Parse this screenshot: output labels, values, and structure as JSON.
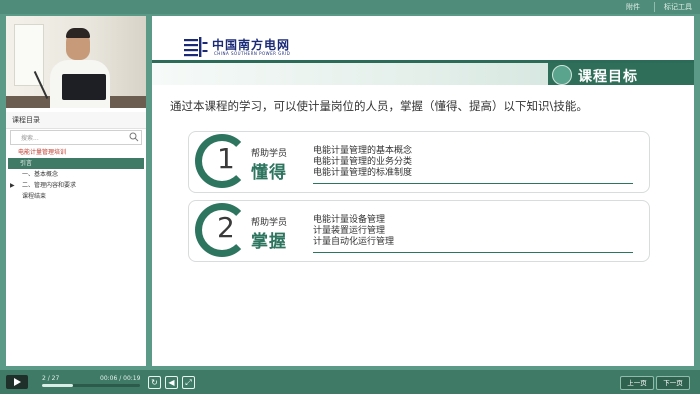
{
  "topbar": {
    "attachment": "附件",
    "tools": "标记工具"
  },
  "sidebar": {
    "catalog_title": "课程目录",
    "search_placeholder": "搜索...",
    "tree": [
      {
        "label": "电能计量管理培训",
        "style": "red"
      },
      {
        "label": "引言",
        "style": "selected"
      },
      {
        "label": "一、基本概念",
        "style": "normal"
      },
      {
        "label": "二、管理内容和要求",
        "style": "collapsed"
      },
      {
        "label": "课程结束",
        "style": "normal"
      }
    ]
  },
  "slide": {
    "logo_cn": "中国南方电网",
    "logo_en": "CHINA SOUTHERN POWER GRID",
    "banner_title": "课程目标",
    "intro": "通过本课程的学习，可以使计量岗位的人员，掌握（懂得、提高）以下知识\\技能。",
    "cards": [
      {
        "number": "1",
        "help": "帮助学员",
        "verb": "懂得",
        "items": [
          "电能计量管理的基本概念",
          "电能计量管理的业务分类",
          "电能计量管理的标准制度"
        ]
      },
      {
        "number": "2",
        "help": "帮助学员",
        "verb": "掌握",
        "items": [
          "电能计量设备管理",
          "计量装置运行管理",
          "计量自动化运行管理"
        ]
      }
    ]
  },
  "player": {
    "page": "2 / 27",
    "time": "00:06 / 00:19",
    "progress_fraction": 0.32,
    "prev_label": "上一页",
    "next_label": "下一页",
    "accent": "#3e7a66"
  }
}
